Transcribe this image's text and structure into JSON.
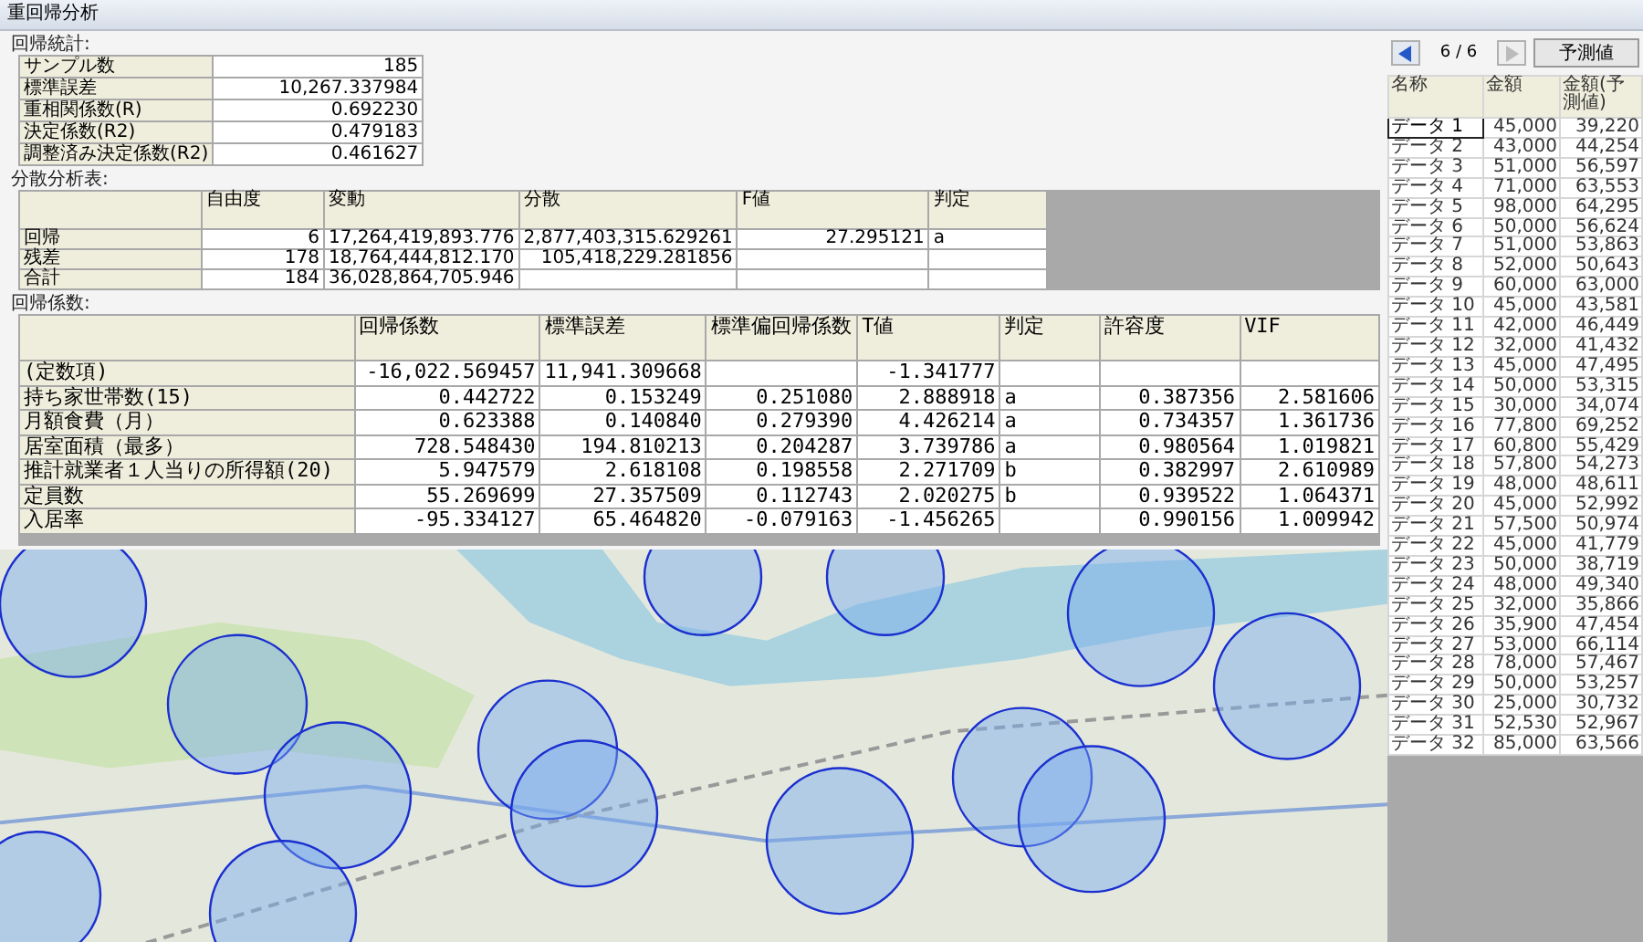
{
  "window": {
    "title": "重回帰分析"
  },
  "regression_stats": {
    "label": "回帰統計:",
    "rows": [
      {
        "name": "サンプル数",
        "value": "185"
      },
      {
        "name": "標準誤差",
        "value": "10,267.337984"
      },
      {
        "name": "重相関係数(R)",
        "value": "0.692230"
      },
      {
        "name": "決定係数(R2)",
        "value": "0.479183"
      },
      {
        "name": "調整済み決定係数(R2)",
        "value": "0.461627"
      }
    ]
  },
  "anova": {
    "label": "分散分析表:",
    "columns": [
      "自由度",
      "変動",
      "分散",
      "F値",
      "判定"
    ],
    "rows": [
      {
        "name": "回帰",
        "cells": [
          "6",
          "17,264,419,893.776",
          "2,877,403,315.629261",
          "27.295121",
          "a"
        ]
      },
      {
        "name": "残差",
        "cells": [
          "178",
          "18,764,444,812.170",
          "105,418,229.281856",
          null,
          null
        ]
      },
      {
        "name": "合計",
        "cells": [
          "184",
          "36,028,864,705.946",
          null,
          null,
          null
        ]
      }
    ]
  },
  "coefficients": {
    "label": "回帰係数:",
    "columns": [
      "回帰係数",
      "標準誤差",
      "標準偏回帰係数",
      "T値",
      "判定",
      "許容度",
      "VIF"
    ],
    "rows": [
      {
        "name": "(定数項)",
        "cells": [
          "-16,022.569457",
          "11,941.309668",
          null,
          "-1.341777",
          null,
          null,
          null
        ]
      },
      {
        "name": "持ち家世帯数(15)",
        "cells": [
          "0.442722",
          "0.153249",
          "0.251080",
          "2.888918",
          "a",
          "0.387356",
          "2.581606"
        ]
      },
      {
        "name": "月額食費（月）",
        "cells": [
          "0.623388",
          "0.140840",
          "0.279390",
          "4.426214",
          "a",
          "0.734357",
          "1.361736"
        ]
      },
      {
        "name": "居室面積（最多）",
        "cells": [
          "728.548430",
          "194.810213",
          "0.204287",
          "3.739786",
          "a",
          "0.980564",
          "1.019821"
        ]
      },
      {
        "name": "推計就業者１人当りの所得額(20)",
        "cells": [
          "5.947579",
          "2.618108",
          "0.198558",
          "2.271709",
          "b",
          "0.382997",
          "2.610989"
        ]
      },
      {
        "name": "定員数",
        "cells": [
          "55.269699",
          "27.357509",
          "0.112743",
          "2.020275",
          "b",
          "0.939522",
          "1.064371"
        ]
      },
      {
        "name": "入居率",
        "cells": [
          "-95.334127",
          "65.464820",
          "-0.079163",
          "-1.456265",
          null,
          "0.990156",
          "1.009942"
        ]
      }
    ]
  },
  "predictions": {
    "page": "6 / 6",
    "prev_disabled": false,
    "next_disabled": true,
    "button": "予測値",
    "columns": [
      "名称",
      "金額",
      "金額(予測値)"
    ],
    "rows": [
      {
        "name": "データ 1",
        "amount": "45,000",
        "predicted": "39,220",
        "focused": true
      },
      {
        "name": "データ 2",
        "amount": "43,000",
        "predicted": "44,254",
        "focused": false
      },
      {
        "name": "データ 3",
        "amount": "51,000",
        "predicted": "56,597",
        "focused": false
      },
      {
        "name": "データ 4",
        "amount": "71,000",
        "predicted": "63,553",
        "focused": false
      },
      {
        "name": "データ 5",
        "amount": "98,000",
        "predicted": "64,295",
        "focused": false
      },
      {
        "name": "データ 6",
        "amount": "50,000",
        "predicted": "56,624",
        "focused": false
      },
      {
        "name": "データ 7",
        "amount": "51,000",
        "predicted": "53,863",
        "focused": false
      },
      {
        "name": "データ 8",
        "amount": "52,000",
        "predicted": "50,643",
        "focused": false
      },
      {
        "name": "データ 9",
        "amount": "60,000",
        "predicted": "63,000",
        "focused": false
      },
      {
        "name": "データ 10",
        "amount": "45,000",
        "predicted": "43,581",
        "focused": false
      },
      {
        "name": "データ 11",
        "amount": "42,000",
        "predicted": "46,449",
        "focused": false
      },
      {
        "name": "データ 12",
        "amount": "32,000",
        "predicted": "41,432",
        "focused": false
      },
      {
        "name": "データ 13",
        "amount": "45,000",
        "predicted": "47,495",
        "focused": false
      },
      {
        "name": "データ 14",
        "amount": "50,000",
        "predicted": "53,315",
        "focused": false
      },
      {
        "name": "データ 15",
        "amount": "30,000",
        "predicted": "34,074",
        "focused": false
      },
      {
        "name": "データ 16",
        "amount": "77,800",
        "predicted": "69,252",
        "focused": false
      },
      {
        "name": "データ 17",
        "amount": "60,800",
        "predicted": "55,429",
        "focused": false
      },
      {
        "name": "データ 18",
        "amount": "57,800",
        "predicted": "54,273",
        "focused": false
      },
      {
        "name": "データ 19",
        "amount": "48,000",
        "predicted": "48,611",
        "focused": false
      },
      {
        "name": "データ 20",
        "amount": "45,000",
        "predicted": "52,992",
        "focused": false
      },
      {
        "name": "データ 21",
        "amount": "57,500",
        "predicted": "50,974",
        "focused": false
      },
      {
        "name": "データ 22",
        "amount": "45,000",
        "predicted": "41,779",
        "focused": false
      },
      {
        "name": "データ 23",
        "amount": "50,000",
        "predicted": "38,719",
        "focused": false
      },
      {
        "name": "データ 24",
        "amount": "48,000",
        "predicted": "49,340",
        "focused": false
      },
      {
        "name": "データ 25",
        "amount": "32,000",
        "predicted": "35,866",
        "focused": false
      },
      {
        "name": "データ 26",
        "amount": "35,900",
        "predicted": "47,454",
        "focused": false
      },
      {
        "name": "データ 27",
        "amount": "53,000",
        "predicted": "66,114",
        "focused": false
      },
      {
        "name": "データ 28",
        "amount": "78,000",
        "predicted": "57,467",
        "focused": false
      },
      {
        "name": "データ 29",
        "amount": "50,000",
        "predicted": "53,257",
        "focused": false
      },
      {
        "name": "データ 30",
        "amount": "25,000",
        "predicted": "30,732",
        "focused": false
      },
      {
        "name": "データ 31",
        "amount": "52,530",
        "predicted": "52,967",
        "focused": false
      },
      {
        "name": "データ 32",
        "amount": "85,000",
        "predicted": "63,566",
        "focused": false
      }
    ]
  }
}
